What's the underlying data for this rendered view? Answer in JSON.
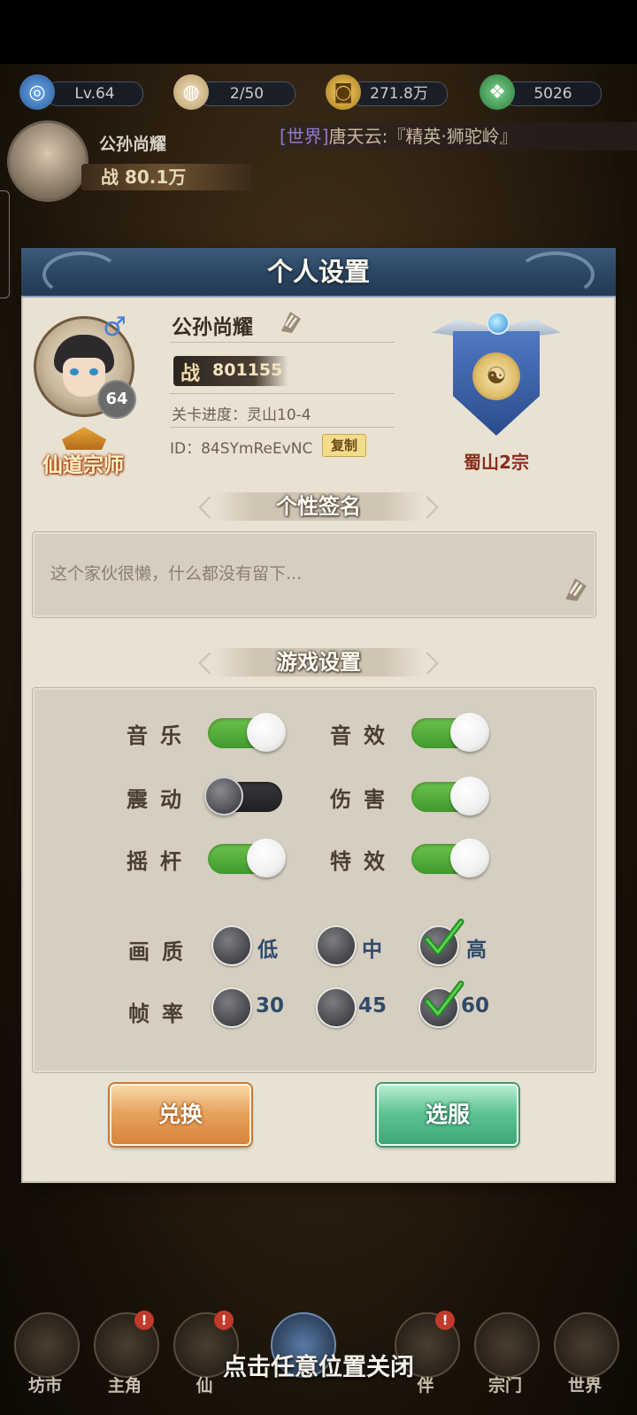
{
  "hud": {
    "level": "Lv.64",
    "stamina": "2/50",
    "coins": "271.8万",
    "jade": "5026",
    "player_name": "公孙尚耀",
    "power_label": "战",
    "power_value": "80.1万",
    "chat_tag": "[世界]",
    "chat_text": "唐天云:『精英·狮驼岭』"
  },
  "dialog": {
    "title": "个人设置",
    "profile": {
      "name": "公孙尚耀",
      "level": "64",
      "gender_symbol": "♂",
      "title_badge": "仙道宗师",
      "power_label": "战",
      "power_value": "801155",
      "stage": "关卡进度：灵山10-4",
      "uid": "ID：84SYmReEvNC",
      "copy_label": "复制",
      "sect_name": "蜀山2宗"
    },
    "signature": {
      "header": "个性签名",
      "text": "这个家伙很懒，什么都没有留下..."
    },
    "game_settings": {
      "header": "游戏设置",
      "toggles": [
        {
          "label": "音乐",
          "on": true
        },
        {
          "label": "音效",
          "on": true
        },
        {
          "label": "震动",
          "on": false
        },
        {
          "label": "伤害",
          "on": true
        },
        {
          "label": "摇杆",
          "on": true
        },
        {
          "label": "特效",
          "on": true
        }
      ],
      "quality": {
        "label": "画质",
        "options": [
          "低",
          "中",
          "高"
        ],
        "selected": "高"
      },
      "framerate": {
        "label": "帧率",
        "options": [
          "30",
          "45",
          "60"
        ],
        "selected": "60"
      }
    },
    "buttons": {
      "exchange": "兑换",
      "server": "选服"
    }
  },
  "bottom_nav": [
    {
      "label": "坊市",
      "badge": ""
    },
    {
      "label": "主角",
      "badge": "!"
    },
    {
      "label": "仙",
      "badge": "!"
    },
    {
      "label": "",
      "badge": ""
    },
    {
      "label": "",
      "badge": ""
    },
    {
      "label": "伴",
      "badge": "!"
    },
    {
      "label": "宗门",
      "badge": ""
    },
    {
      "label": "世界",
      "badge": ""
    }
  ],
  "close_hint": "点击任意位置关闭",
  "colors": {
    "toggle_on": "#4fae36",
    "toggle_off": "#2a2a2e",
    "dialog_bg": "#e9e2d3",
    "header_bg": "#2a4461",
    "exchange_btn": "#e8a460",
    "server_btn": "#5fc595"
  }
}
